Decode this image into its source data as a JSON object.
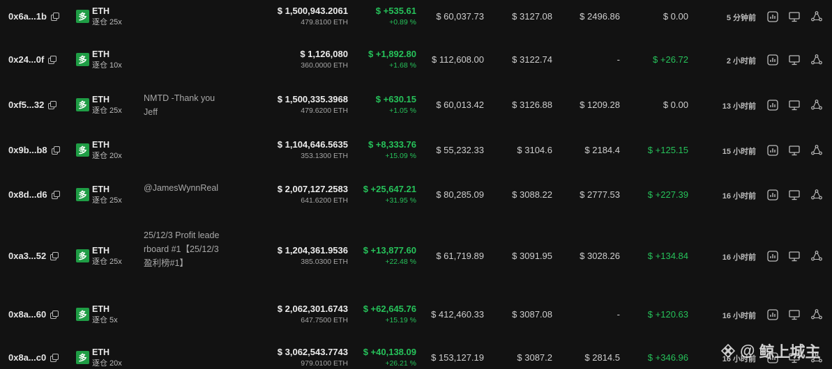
{
  "rows": [
    {
      "address": "0x6a...1b",
      "side": "多",
      "symbol": "ETH",
      "leverage": "逐仓 25x",
      "note": "",
      "value": "$ 1,500,943.2061",
      "size": "479.8100 ETH",
      "pnl": "$ +535.61",
      "pnl_pct": "+0.89 %",
      "margin": "$ 60,037.73",
      "entry": "$ 3127.08",
      "liq": "$ 2496.86",
      "funding": "$ 0.00",
      "funding_positive": false,
      "time": "5 分钟前"
    },
    {
      "address": "0x24...0f",
      "side": "多",
      "symbol": "ETH",
      "leverage": "逐仓 10x",
      "note": "",
      "value": "$ 1,126,080",
      "size": "360.0000 ETH",
      "pnl": "$ +1,892.80",
      "pnl_pct": "+1.68 %",
      "margin": "$ 112,608.00",
      "entry": "$ 3122.74",
      "liq": "-",
      "funding": "$ +26.72",
      "funding_positive": true,
      "time": "2 小时前"
    },
    {
      "address": "0xf5...32",
      "side": "多",
      "symbol": "ETH",
      "leverage": "逐仓 25x",
      "note": "NMTD -Thank you Jeff",
      "value": "$ 1,500,335.3968",
      "size": "479.6200 ETH",
      "pnl": "$ +630.15",
      "pnl_pct": "+1.05 %",
      "margin": "$ 60,013.42",
      "entry": "$ 3126.88",
      "liq": "$ 1209.28",
      "funding": "$ 0.00",
      "funding_positive": false,
      "time": "13 小时前"
    },
    {
      "address": "0x9b...b8",
      "side": "多",
      "symbol": "ETH",
      "leverage": "逐仓 20x",
      "note": "",
      "value": "$ 1,104,646.5635",
      "size": "353.1300 ETH",
      "pnl": "$ +8,333.76",
      "pnl_pct": "+15.09 %",
      "margin": "$ 55,232.33",
      "entry": "$ 3104.6",
      "liq": "$ 2184.4",
      "funding": "$ +125.15",
      "funding_positive": true,
      "time": "15 小时前"
    },
    {
      "address": "0x8d...d6",
      "side": "多",
      "symbol": "ETH",
      "leverage": "逐仓 25x",
      "note": "@JamesWynnReal",
      "value": "$ 2,007,127.2583",
      "size": "641.6200 ETH",
      "pnl": "$ +25,647.21",
      "pnl_pct": "+31.95 %",
      "margin": "$ 80,285.09",
      "entry": "$ 3088.22",
      "liq": "$ 2777.53",
      "funding": "$ +227.39",
      "funding_positive": true,
      "time": "16 小时前"
    },
    {
      "address": "0xa3...52",
      "side": "多",
      "symbol": "ETH",
      "leverage": "逐仓 25x",
      "note": "25/12/3 Profit leaderboard #1【25/12/3盈利榜#1】",
      "value": "$ 1,204,361.9536",
      "size": "385.0300 ETH",
      "pnl": "$ +13,877.60",
      "pnl_pct": "+22.48 %",
      "margin": "$ 61,719.89",
      "entry": "$ 3091.95",
      "liq": "$ 3028.26",
      "funding": "$ +134.84",
      "funding_positive": true,
      "time": "16 小时前"
    },
    {
      "address": "0x8a...60",
      "side": "多",
      "symbol": "ETH",
      "leverage": "逐仓 5x",
      "note": "",
      "value": "$ 2,062,301.6743",
      "size": "647.7500 ETH",
      "pnl": "$ +62,645.76",
      "pnl_pct": "+15.19 %",
      "margin": "$ 412,460.33",
      "entry": "$ 3087.08",
      "liq": "-",
      "funding": "$ +120.63",
      "funding_positive": true,
      "time": "16 小时前"
    },
    {
      "address": "0x8a...c0",
      "side": "多",
      "symbol": "ETH",
      "leverage": "逐仓 20x",
      "note": "",
      "value": "$ 3,062,543.7743",
      "size": "979.0100 ETH",
      "pnl": "$ +40,138.09",
      "pnl_pct": "+26.21 %",
      "margin": "$ 153,127.19",
      "entry": "$ 3087.2",
      "liq": "$ 2814.5",
      "funding": "$ +346.96",
      "funding_positive": true,
      "time": "16 小时前"
    }
  ],
  "icons": {
    "chart": "bar-chart-icon",
    "monitor": "monitor-icon",
    "share": "share-icon"
  },
  "colors": {
    "background": "#121212",
    "positive": "#26c25a",
    "badge": "#1f9d45"
  },
  "watermark": {
    "at": "@",
    "text": "鲸上城主"
  }
}
